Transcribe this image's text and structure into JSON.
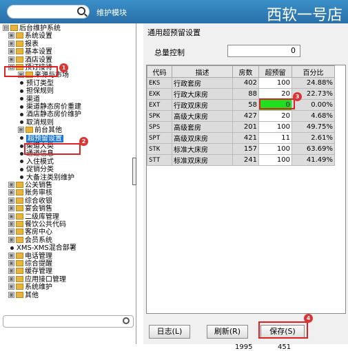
{
  "header": {
    "module_label": "维护模块",
    "app_title": "西软一号店"
  },
  "tree": {
    "items": [
      {
        "label": "后台维护系统",
        "kind": "folder",
        "exp": "⊟"
      },
      {
        "label": "系统设置",
        "kind": "folder",
        "exp": "⊞"
      },
      {
        "label": "报表",
        "kind": "folder",
        "exp": "⊞"
      },
      {
        "label": "基本设置",
        "kind": "folder",
        "exp": "⊞"
      },
      {
        "label": "酒店设置",
        "kind": "folder",
        "exp": "⊞"
      },
      {
        "label": "预订接待",
        "kind": "folder",
        "exp": "⊟"
      },
      {
        "label": "来源与市场",
        "kind": "folder",
        "exp": "⊞"
      },
      {
        "label": "预订类型",
        "kind": "leaf"
      },
      {
        "label": "担保规则",
        "kind": "leaf"
      },
      {
        "label": "渠道",
        "kind": "leaf"
      },
      {
        "label": "渠道静态房价重建",
        "kind": "leaf"
      },
      {
        "label": "酒店静态房价维护",
        "kind": "leaf"
      },
      {
        "label": "取消规则",
        "kind": "leaf"
      },
      {
        "label": "前台其他",
        "kind": "folder",
        "exp": "⊞"
      },
      {
        "label": "超预留设置",
        "kind": "leaf",
        "selected": true
      },
      {
        "label": "渠道大类",
        "kind": "leaf"
      },
      {
        "label": "通道信息",
        "kind": "leaf"
      },
      {
        "label": "入住模式",
        "kind": "leaf"
      },
      {
        "label": "促销分类",
        "kind": "leaf"
      },
      {
        "label": "大备注类别维护",
        "kind": "leaf"
      },
      {
        "label": "公关销售",
        "kind": "folder",
        "exp": "⊞"
      },
      {
        "label": "账务审核",
        "kind": "folder",
        "exp": "⊞"
      },
      {
        "label": "综合收银",
        "kind": "folder",
        "exp": "⊞"
      },
      {
        "label": "宴会销售",
        "kind": "folder",
        "exp": "⊞"
      },
      {
        "label": "二级库管理",
        "kind": "folder",
        "exp": "⊞"
      },
      {
        "label": "餐饮公共代码",
        "kind": "folder",
        "exp": "⊞"
      },
      {
        "label": "客房中心",
        "kind": "folder",
        "exp": "⊞"
      },
      {
        "label": "会员系统",
        "kind": "folder",
        "exp": "⊞"
      },
      {
        "label": "XMS-XMS混合部署",
        "kind": "leaf"
      },
      {
        "label": "电话管理",
        "kind": "folder",
        "exp": "⊞"
      },
      {
        "label": "综合提醒",
        "kind": "folder",
        "exp": "⊞"
      },
      {
        "label": "缓存管理",
        "kind": "folder",
        "exp": "⊞"
      },
      {
        "label": "应用接口管理",
        "kind": "folder",
        "exp": "⊞"
      },
      {
        "label": "系统维护",
        "kind": "folder",
        "exp": "⊞"
      },
      {
        "label": "其他",
        "kind": "folder",
        "exp": "⊞"
      }
    ]
  },
  "panel": {
    "title": "通用超预留设置",
    "total_control_label": "总量控制",
    "total_control_value": "0"
  },
  "table": {
    "columns": [
      "代码",
      "描述",
      "房数",
      "超预留",
      "百分比"
    ],
    "rows": [
      {
        "code": "EKS",
        "desc": "行政套房",
        "rooms": "402",
        "over": "100",
        "pct": "24.88%"
      },
      {
        "code": "EXK",
        "desc": "行政大床房",
        "rooms": "88",
        "over": "20",
        "pct": "22.73%"
      },
      {
        "code": "EXT",
        "desc": "行政双床房",
        "rooms": "58",
        "over": "0",
        "pct": "0.00%"
      },
      {
        "code": "SPK",
        "desc": "高级大床房",
        "rooms": "427",
        "over": "20",
        "pct": "4.68%"
      },
      {
        "code": "SPS",
        "desc": "高级套房",
        "rooms": "201",
        "over": "100",
        "pct": "49.75%"
      },
      {
        "code": "SPT",
        "desc": "高级双床房",
        "rooms": "421",
        "over": "11",
        "pct": "2.61%"
      },
      {
        "code": "STK",
        "desc": "标准大床房",
        "rooms": "157",
        "over": "100",
        "pct": "63.69%"
      },
      {
        "code": "STT",
        "desc": "标准双床房",
        "rooms": "241",
        "over": "100",
        "pct": "41.49%"
      }
    ],
    "total_rooms": "1995",
    "total_over": "451"
  },
  "buttons": {
    "log": "日志(L)",
    "refresh": "刷新(R)",
    "save": "保存(S)"
  },
  "badges": [
    "1",
    "2",
    "3",
    "4"
  ]
}
